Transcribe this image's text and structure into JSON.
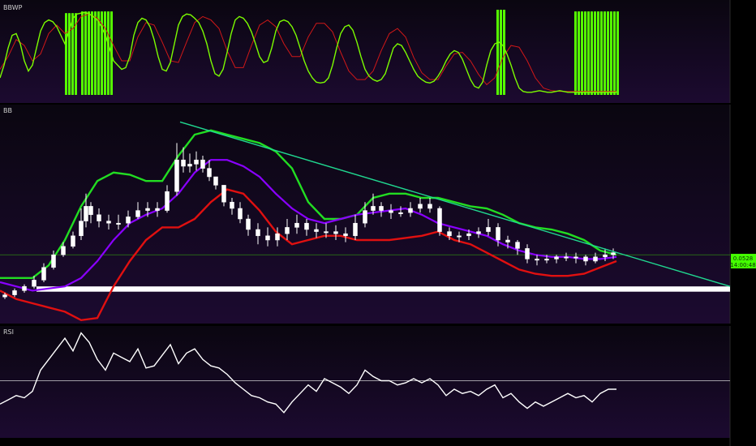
{
  "colors": {
    "background_top": "#0a0610",
    "background_bottom": "#1c0a30",
    "bbwp_line": "#7CFC00",
    "bbwp_signal": "#d01818",
    "bbwp_bar": "#55ff00",
    "bb_upper": "#22dd22",
    "bb_basis": "#8a00ff",
    "bb_lower": "#e01010",
    "candle_up": "#ffffff",
    "candle_down": "#ffffff",
    "trendline": "#20d890",
    "support_zone": "#ffffff",
    "rsi_line": "#ffffff",
    "price_badge": "#44ff00"
  },
  "panes": {
    "bbwp_label": "BBWP",
    "bb_label": "BB",
    "rsi_label": "RSI"
  },
  "price_badge": {
    "price": "0.0528",
    "countdown": "14:00:48"
  },
  "chart_data": [
    {
      "type": "line",
      "pane": "BBWP",
      "ylim": [
        0,
        100
      ],
      "series": [
        {
          "role": "bbwp",
          "x": [
            0,
            5,
            10,
            15,
            20,
            25,
            30,
            35,
            40,
            45,
            50,
            55,
            60,
            65,
            70,
            75,
            80,
            85,
            90,
            95,
            100,
            105,
            110,
            115,
            120,
            125,
            130,
            135,
            140,
            145,
            150,
            155,
            160,
            165,
            170,
            175,
            180,
            185,
            190,
            195,
            200,
            205,
            210,
            215,
            220,
            225,
            230,
            235,
            240,
            245,
            250,
            255,
            260,
            265,
            270,
            275,
            280,
            285,
            290,
            295,
            300,
            305,
            310,
            315,
            320,
            325,
            330,
            335,
            340,
            345,
            350,
            355,
            360,
            365,
            370,
            375,
            380,
            385,
            390,
            395,
            400,
            405,
            410,
            415,
            420,
            425,
            430,
            435,
            440,
            445,
            450,
            455,
            460,
            465,
            470,
            475,
            480,
            485,
            490,
            495,
            500,
            505,
            510,
            515,
            520,
            525,
            530,
            535,
            540,
            545,
            550,
            555,
            560,
            565,
            570,
            575,
            580,
            585,
            590,
            595,
            600,
            605,
            610,
            615,
            620,
            625,
            630,
            635,
            640,
            645,
            650,
            655,
            660,
            665,
            670,
            675,
            680,
            685,
            690,
            695,
            700,
            705,
            710,
            715,
            720,
            725,
            730,
            735,
            740,
            745,
            750,
            755,
            760
          ],
          "values": [
            20,
            35,
            55,
            70,
            72,
            60,
            40,
            28,
            35,
            55,
            75,
            85,
            88,
            86,
            80,
            70,
            60,
            75,
            90,
            95,
            96,
            97,
            95,
            92,
            88,
            80,
            70,
            55,
            40,
            35,
            30,
            32,
            45,
            70,
            85,
            90,
            88,
            80,
            65,
            45,
            30,
            28,
            38,
            60,
            82,
            92,
            95,
            94,
            90,
            85,
            75,
            60,
            40,
            25,
            22,
            30,
            50,
            72,
            88,
            92,
            90,
            84,
            74,
            60,
            45,
            38,
            40,
            55,
            75,
            86,
            88,
            86,
            80,
            70,
            55,
            40,
            28,
            20,
            15,
            14,
            15,
            20,
            35,
            55,
            72,
            80,
            82,
            76,
            62,
            45,
            30,
            22,
            18,
            16,
            18,
            25,
            40,
            55,
            60,
            58,
            50,
            40,
            30,
            22,
            18,
            15,
            14,
            16,
            22,
            30,
            40,
            48,
            52,
            50,
            42,
            30,
            18,
            10,
            8,
            15,
            35,
            52,
            60,
            62,
            58,
            48,
            35,
            20,
            8,
            4,
            3,
            3,
            4,
            5,
            4,
            3,
            3,
            4,
            5,
            4,
            3,
            3,
            3,
            3,
            3,
            3,
            3,
            3,
            3,
            3,
            3,
            3,
            3
          ]
        },
        {
          "role": "signal",
          "x": [
            0,
            10,
            20,
            30,
            40,
            50,
            60,
            70,
            80,
            90,
            100,
            110,
            120,
            130,
            140,
            150,
            160,
            170,
            180,
            190,
            200,
            210,
            220,
            230,
            240,
            250,
            260,
            270,
            280,
            290,
            300,
            310,
            320,
            330,
            340,
            350,
            360,
            370,
            380,
            390,
            400,
            410,
            420,
            430,
            440,
            450,
            460,
            470,
            480,
            490,
            500,
            510,
            520,
            530,
            540,
            550,
            560,
            570,
            580,
            590,
            600,
            610,
            620,
            630,
            640,
            650,
            660,
            670,
            680,
            690,
            700,
            710,
            720,
            730,
            740,
            750,
            760
          ],
          "values": [
            30,
            45,
            65,
            58,
            40,
            48,
            72,
            82,
            72,
            78,
            92,
            95,
            90,
            78,
            58,
            40,
            40,
            68,
            85,
            82,
            62,
            40,
            38,
            62,
            85,
            92,
            88,
            78,
            52,
            32,
            32,
            58,
            82,
            88,
            80,
            60,
            45,
            45,
            68,
            84,
            84,
            74,
            50,
            28,
            18,
            18,
            28,
            52,
            72,
            78,
            68,
            44,
            26,
            18,
            18,
            34,
            48,
            50,
            40,
            24,
            12,
            20,
            44,
            58,
            56,
            40,
            20,
            8,
            5,
            4,
            4,
            4,
            4,
            4,
            4,
            4,
            4
          ]
        }
      ],
      "bars": [
        {
          "x_start": 80,
          "x_end": 96,
          "value": 96
        },
        {
          "x_start": 100,
          "x_end": 140,
          "value": 98
        },
        {
          "x_start": 612,
          "x_end": 622,
          "value": 100
        },
        {
          "x_start": 708,
          "x_end": 764,
          "value": 98
        }
      ]
    },
    {
      "type": "candlestick",
      "pane": "BB",
      "ylim": [
        0,
        100
      ],
      "trendline": {
        "x1": 222,
        "y1": 96,
        "x2": 900,
        "y2": 18
      },
      "support_zone": {
        "y_low": 15.5,
        "y_high": 18
      },
      "current_price_line": 33,
      "bands": {
        "x": [
          0,
          20,
          40,
          60,
          80,
          100,
          120,
          140,
          160,
          180,
          200,
          220,
          240,
          260,
          280,
          300,
          320,
          340,
          360,
          380,
          400,
          420,
          440,
          460,
          480,
          500,
          520,
          540,
          560,
          580,
          600,
          620,
          640,
          660,
          680,
          700,
          720,
          740,
          760
        ],
        "upper": [
          22,
          22,
          22,
          28,
          40,
          56,
          68,
          72,
          71,
          68,
          68,
          80,
          90,
          92,
          90,
          88,
          86,
          82,
          74,
          58,
          50,
          50,
          52,
          60,
          62,
          62,
          60,
          60,
          58,
          56,
          55,
          52,
          48,
          46,
          45,
          43,
          40,
          35,
          33
        ],
        "basis": [
          20,
          18,
          16,
          17,
          18,
          22,
          30,
          40,
          48,
          52,
          55,
          62,
          72,
          78,
          78,
          75,
          70,
          62,
          55,
          50,
          48,
          50,
          52,
          53,
          54,
          55,
          52,
          48,
          46,
          44,
          42,
          38,
          35,
          33,
          32,
          32,
          31,
          31,
          32
        ],
        "lower": [
          16,
          12,
          10,
          8,
          6,
          2,
          3,
          18,
          30,
          40,
          46,
          46,
          50,
          58,
          64,
          62,
          54,
          44,
          38,
          40,
          42,
          42,
          40,
          40,
          40,
          41,
          42,
          44,
          40,
          38,
          34,
          30,
          26,
          24,
          23,
          23,
          24,
          27,
          30
        ]
      },
      "candles": {
        "x": [
          6,
          18,
          30,
          42,
          54,
          66,
          78,
          90,
          100,
          106,
          112,
          122,
          134,
          146,
          158,
          170,
          182,
          194,
          206,
          218,
          226,
          234,
          242,
          250,
          258,
          266,
          276,
          286,
          296,
          306,
          318,
          330,
          342,
          354,
          366,
          378,
          390,
          402,
          414,
          426,
          438,
          450,
          460,
          470,
          482,
          494,
          506,
          518,
          530,
          542,
          554,
          566,
          578,
          590,
          602,
          614,
          626,
          638,
          650,
          662,
          674,
          686,
          698,
          710,
          722,
          734,
          746,
          756
        ],
        "open": [
          13,
          14,
          16,
          18,
          21,
          27,
          33,
          37,
          42,
          49,
          56,
          52,
          49,
          48,
          48,
          51,
          54,
          55,
          54,
          63,
          78,
          75,
          76,
          78,
          74,
          70,
          66,
          58,
          55,
          50,
          45,
          42,
          40,
          43,
          46,
          48,
          45,
          44,
          44,
          43,
          42,
          48,
          54,
          56,
          54,
          53,
          53,
          55,
          57,
          55,
          44,
          42,
          42,
          43,
          44,
          46,
          40,
          39,
          36,
          31,
          31,
          31,
          32,
          32,
          32,
          30,
          32,
          33
        ],
        "close": [
          14,
          16,
          18,
          21,
          27,
          33,
          37,
          42,
          49,
          56,
          52,
          49,
          48,
          48,
          51,
          54,
          55,
          54,
          63,
          78,
          75,
          76,
          78,
          74,
          70,
          66,
          58,
          55,
          50,
          45,
          42,
          40,
          43,
          46,
          48,
          45,
          44,
          44,
          43,
          42,
          48,
          54,
          56,
          54,
          53,
          53,
          55,
          57,
          55,
          44,
          42,
          42,
          43,
          44,
          46,
          40,
          39,
          36,
          31,
          31,
          31,
          32,
          32,
          32,
          30,
          32,
          33,
          34
        ],
        "high": [
          15,
          17,
          19,
          23,
          29,
          35,
          39,
          44,
          55,
          62,
          58,
          55,
          52,
          52,
          54,
          58,
          58,
          58,
          66,
          86,
          84,
          81,
          82,
          80,
          78,
          70,
          66,
          60,
          58,
          52,
          48,
          46,
          46,
          50,
          52,
          50,
          48,
          48,
          47,
          46,
          52,
          58,
          62,
          58,
          57,
          56,
          58,
          60,
          60,
          56,
          46,
          44,
          45,
          46,
          50,
          48,
          42,
          40,
          38,
          33,
          33,
          33,
          34,
          34,
          33,
          34,
          36,
          36
        ],
        "low": [
          12,
          13,
          15,
          17,
          20,
          26,
          32,
          36,
          40,
          46,
          48,
          46,
          45,
          45,
          46,
          50,
          51,
          51,
          53,
          61,
          72,
          72,
          73,
          72,
          68,
          64,
          56,
          52,
          48,
          42,
          38,
          37,
          37,
          40,
          43,
          42,
          41,
          41,
          40,
          39,
          40,
          46,
          52,
          51,
          50,
          51,
          51,
          53,
          53,
          42,
          40,
          39,
          40,
          41,
          42,
          37,
          36,
          33,
          29,
          28,
          29,
          29,
          30,
          29,
          28,
          29,
          30,
          31
        ]
      }
    },
    {
      "type": "line",
      "pane": "RSI",
      "ylim": [
        0,
        100
      ],
      "reference_line": 50,
      "series": [
        {
          "x": [
            0,
            10,
            20,
            30,
            40,
            50,
            60,
            70,
            80,
            90,
            100,
            110,
            120,
            130,
            140,
            150,
            160,
            170,
            180,
            190,
            200,
            210,
            220,
            230,
            240,
            250,
            260,
            270,
            280,
            290,
            300,
            310,
            320,
            330,
            340,
            350,
            360,
            370,
            380,
            390,
            400,
            410,
            420,
            430,
            440,
            450,
            460,
            470,
            480,
            490,
            500,
            510,
            520,
            530,
            540,
            550,
            560,
            570,
            580,
            590,
            600,
            610,
            620,
            630,
            640,
            650,
            660,
            670,
            680,
            690,
            700,
            710,
            720,
            730,
            740,
            750,
            760
          ],
          "values": [
            28,
            32,
            36,
            34,
            40,
            60,
            70,
            80,
            90,
            78,
            95,
            86,
            70,
            60,
            76,
            72,
            68,
            80,
            62,
            64,
            74,
            84,
            66,
            76,
            80,
            70,
            64,
            62,
            56,
            48,
            42,
            36,
            34,
            30,
            28,
            20,
            30,
            38,
            46,
            40,
            52,
            48,
            44,
            38,
            46,
            60,
            54,
            50,
            50,
            46,
            48,
            52,
            48,
            52,
            46,
            36,
            42,
            38,
            40,
            36,
            42,
            46,
            34,
            38,
            30,
            24,
            30,
            26,
            30,
            34,
            38,
            34,
            36,
            30,
            38,
            42,
            42
          ]
        }
      ]
    }
  ]
}
